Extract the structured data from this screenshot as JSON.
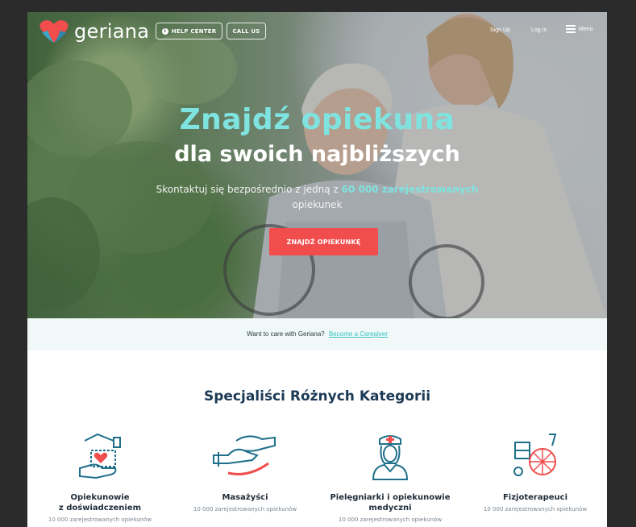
{
  "header": {
    "logo_text": "geriana",
    "help_center_label": "HELP CENTER",
    "call_us_label": "CALL US",
    "signup_label": "Sign Up",
    "login_label": "Log In",
    "menu_label": "Menu"
  },
  "hero": {
    "title_line1": "Znajdź  opiekuna",
    "title_line2": "dla swoich najbliższych",
    "subtitle_prefix": "Skontaktuj się bezpośrednio z jedną z",
    "subtitle_highlight": "60 000 zarejestrowanych",
    "subtitle_suffix": "opiekunek",
    "cta_label": "ZNAJDŹ OPIEKUNKĘ"
  },
  "caregiver_strip": {
    "text": "Want to care with Geriana?",
    "link": "Become a Caregiver"
  },
  "categories": {
    "title": "Specjaliści Różnych Kategorii",
    "items": [
      {
        "label_line1": "Opiekunowie",
        "label_line2": "z doświadczeniem",
        "desc": "10 000 zarejestrowanych opiekunów",
        "icon": "caring-hands-heart-icon"
      },
      {
        "label_line1": "Masażyści",
        "label_line2": "",
        "desc": "10 000 zarejestrowanych opiekunów",
        "icon": "massage-hands-icon"
      },
      {
        "label_line1": "Pielęgniarki i opiekunowie",
        "label_line2": "medyczni",
        "desc": "10 000 zarejestrowanych opiekunów",
        "icon": "nurse-icon"
      },
      {
        "label_line1": "Fizjoterapeuci",
        "label_line2": "",
        "desc": "10 000 zarejestrowanych opiekunów",
        "icon": "wheelchair-icon"
      }
    ]
  },
  "colors": {
    "accent_teal": "#7fe3e0",
    "cta_red": "#f24d4d",
    "title_navy": "#1c3a55",
    "link_teal": "#35c4c0"
  }
}
